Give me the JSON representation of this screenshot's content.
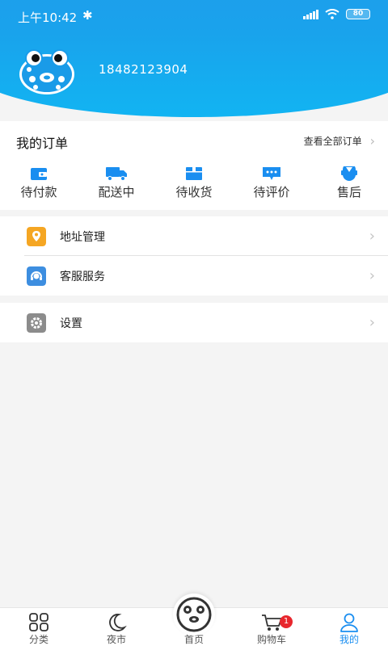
{
  "status_bar": {
    "time": "上午10:42",
    "battery": "80"
  },
  "profile": {
    "phone": "18482123904"
  },
  "orders": {
    "title": "我的订单",
    "view_all": "查看全部订单",
    "items": [
      {
        "label": "待付款",
        "icon": "wallet-icon"
      },
      {
        "label": "配送中",
        "icon": "truck-icon"
      },
      {
        "label": "待收货",
        "icon": "box-icon"
      },
      {
        "label": "待评价",
        "icon": "comment-icon"
      },
      {
        "label": "售后",
        "icon": "service-icon"
      }
    ]
  },
  "menu": {
    "address": "地址管理",
    "support": "客服服务",
    "settings": "设置"
  },
  "tabbar": {
    "items": [
      {
        "label": "分类"
      },
      {
        "label": "夜市"
      },
      {
        "label": "首页"
      },
      {
        "label": "购物车"
      },
      {
        "label": "我的"
      }
    ],
    "cart_badge": "1",
    "active_tab": "我的"
  },
  "colors": {
    "accent": "#1a8ef0",
    "header": "#19a3ec",
    "badge": "#e8262d",
    "address_icon": "#f5a623",
    "support_icon": "#3d8ee0",
    "settings_icon": "#8c8c8c"
  }
}
